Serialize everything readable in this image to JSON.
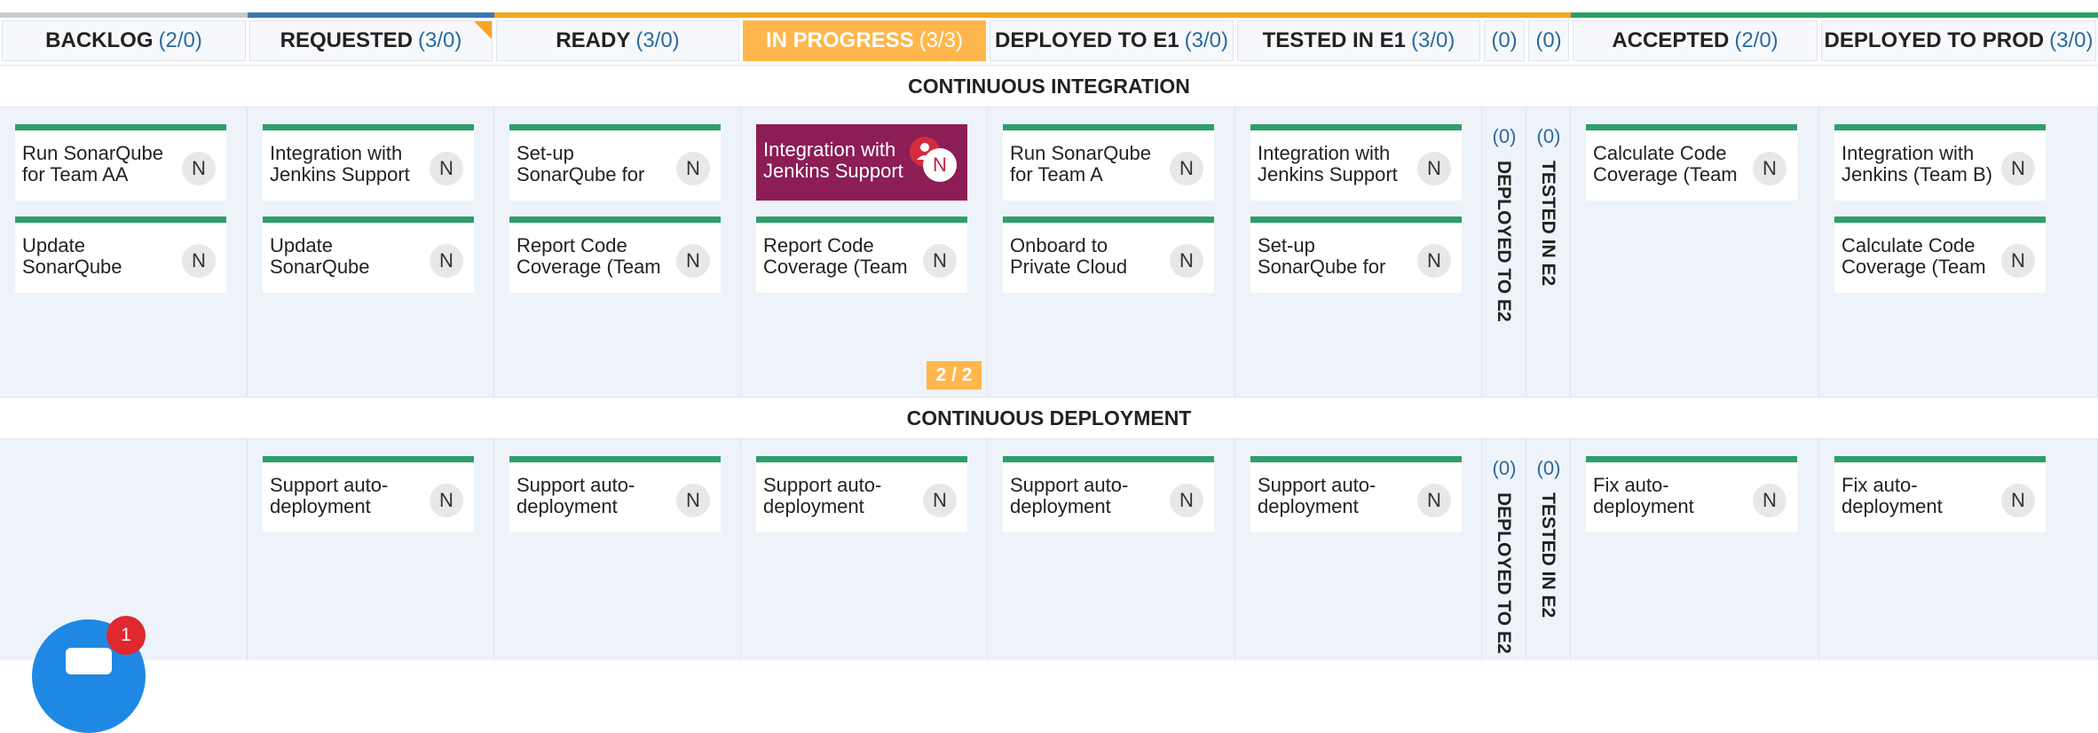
{
  "columns": [
    {
      "id": "backlog",
      "name": "BACKLOG",
      "count": "(2/0)",
      "bar_color": "#c8ccd2"
    },
    {
      "id": "requested",
      "name": "REQUESTED",
      "count": "(3/0)",
      "bar_color": "#3b78b0"
    },
    {
      "id": "ready",
      "name": "READY",
      "count": "(3/0)",
      "bar_color": "#f5a623"
    },
    {
      "id": "in-progress",
      "name": "IN PROGRESS",
      "count": "(3/3)",
      "bar_color": "#f5a623",
      "active": true
    },
    {
      "id": "deployed-e1",
      "name": "DEPLOYED TO E1",
      "count": "(3/0)",
      "bar_color": "#f5a623"
    },
    {
      "id": "tested-e1",
      "name": "TESTED IN E1",
      "count": "(3/0)",
      "bar_color": "#f5a623"
    },
    {
      "id": "deployed-e2",
      "name": "",
      "count": "(0)",
      "bar_color": "#f5a623",
      "narrow": true
    },
    {
      "id": "tested-e2",
      "name": "",
      "count": "(0)",
      "bar_color": "#f5a623",
      "narrow": true
    },
    {
      "id": "accepted",
      "name": "ACCEPTED",
      "count": "(2/0)",
      "bar_color": "#2e9e6b"
    },
    {
      "id": "deployed-prod",
      "name": "DEPLOYED TO PROD",
      "count": "(3/0)",
      "bar_color": "#2e9e6b"
    }
  ],
  "swimlanes": [
    {
      "title": "CONTINUOUS INTEGRATION",
      "wip_badge": "2 / 2",
      "collapsed_labels": {
        "deployed_e2": "DEPLOYED TO E2",
        "tested_e2": "TESTED IN E2",
        "count": "(0)"
      },
      "cards": [
        {
          "col": 0,
          "row": 0,
          "title": "Run SonarQube for Team AA",
          "avatar": "N"
        },
        {
          "col": 0,
          "row": 1,
          "title": "Update SonarQube",
          "avatar": "N"
        },
        {
          "col": 1,
          "row": 0,
          "title": "Integration with Jenkins Support",
          "avatar": "N"
        },
        {
          "col": 1,
          "row": 1,
          "title": "Update SonarQube",
          "avatar": "N"
        },
        {
          "col": 2,
          "row": 0,
          "title": "Set-up SonarQube for",
          "avatar": "N"
        },
        {
          "col": 2,
          "row": 1,
          "title": "Report Code Coverage (Team",
          "avatar": "N"
        },
        {
          "col": 3,
          "row": 0,
          "title": "Integration with Jenkins Support",
          "avatar": "N",
          "highlight": true,
          "icon": "blocked-user-icon"
        },
        {
          "col": 3,
          "row": 1,
          "title": "Report Code Coverage (Team",
          "avatar": "N"
        },
        {
          "col": 4,
          "row": 0,
          "title": "Run SonarQube for Team A",
          "avatar": "N"
        },
        {
          "col": 4,
          "row": 1,
          "title": "Onboard to Private Cloud",
          "avatar": "N"
        },
        {
          "col": 5,
          "row": 0,
          "title": "Integration with Jenkins Support",
          "avatar": "N"
        },
        {
          "col": 5,
          "row": 1,
          "title": "Set-up SonarQube for",
          "avatar": "N"
        },
        {
          "col": 8,
          "row": 0,
          "title": "Calculate Code Coverage (Team",
          "avatar": "N"
        },
        {
          "col": 9,
          "row": 0,
          "title": "Integration with Jenkins (Team B)",
          "avatar": "N"
        },
        {
          "col": 9,
          "row": 1,
          "title": "Calculate Code Coverage (Team",
          "avatar": "N"
        }
      ]
    },
    {
      "title": "CONTINUOUS DEPLOYMENT",
      "collapsed_labels": {
        "deployed_e2": "DEPLOYED TO E2",
        "tested_e2": "TESTED IN E2",
        "count": "(0)"
      },
      "cards": [
        {
          "col": 1,
          "row": 0,
          "title": "Support auto-deployment",
          "avatar": "N"
        },
        {
          "col": 2,
          "row": 0,
          "title": "Support auto-deployment",
          "avatar": "N"
        },
        {
          "col": 3,
          "row": 0,
          "title": "Support auto-deployment",
          "avatar": "N"
        },
        {
          "col": 4,
          "row": 0,
          "title": "Support auto-deployment",
          "avatar": "N"
        },
        {
          "col": 5,
          "row": 0,
          "title": "Support auto-deployment",
          "avatar": "N"
        },
        {
          "col": 8,
          "row": 0,
          "title": "Fix auto-deployment",
          "avatar": "N"
        },
        {
          "col": 9,
          "row": 0,
          "title": "Fix auto-deployment",
          "avatar": "N"
        }
      ]
    }
  ],
  "chat": {
    "badge": "1",
    "icon": "chat-icon",
    "color": "#1f88e5"
  }
}
